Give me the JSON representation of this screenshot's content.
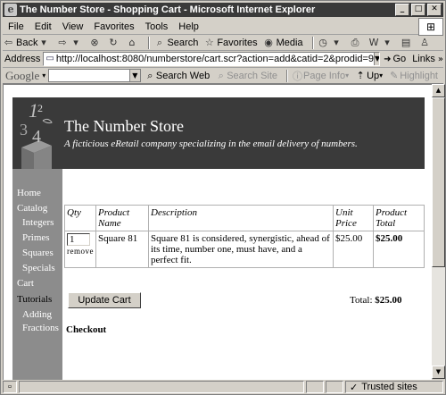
{
  "window": {
    "title": "The Number Store - Shopping Cart - Microsoft Internet Explorer"
  },
  "menu": [
    "File",
    "Edit",
    "View",
    "Favorites",
    "Tools",
    "Help"
  ],
  "toolbar": {
    "back": "Back",
    "search": "Search",
    "favorites": "Favorites",
    "media": "Media"
  },
  "address": {
    "label": "Address",
    "url": "http://localhost:8080/numberstore/cart.scr?action=add&catid=2&prodid=9",
    "go": "Go",
    "links": "Links"
  },
  "google": {
    "logo": "Google",
    "search_web": "Search Web",
    "search_site": "Search Site",
    "page_info": "Page Info",
    "up": "Up",
    "highlight": "Highlight"
  },
  "site": {
    "title": "The Number Store",
    "tagline": "A ficticious eRetail company specializing in the email delivery of numbers."
  },
  "nav": [
    "Home",
    "Catalog",
    "Integers",
    "Primes",
    "Squares",
    "Specials",
    "Cart",
    "Tutorials",
    "Adding",
    "Fractions"
  ],
  "cart": {
    "headers": {
      "qty": "Qty",
      "product_1": "Product",
      "product_2": "Name",
      "desc": "Description",
      "unit_1": "Unit",
      "unit_2": "Price",
      "total_1": "Product",
      "total_2": "Total"
    },
    "rows": [
      {
        "qty": "1",
        "remove": "remove",
        "name": "Square 81",
        "description": "Square 81 is considered, synergistic, ahead of its time, number one, must have, and a perfect fit.",
        "unit_price": "$25.00",
        "total": "$25.00"
      }
    ],
    "update_button": "Update Cart",
    "total_label": "Total:",
    "total_value": "$25.00",
    "checkout": "Checkout"
  },
  "status": {
    "zone": "Trusted sites"
  }
}
